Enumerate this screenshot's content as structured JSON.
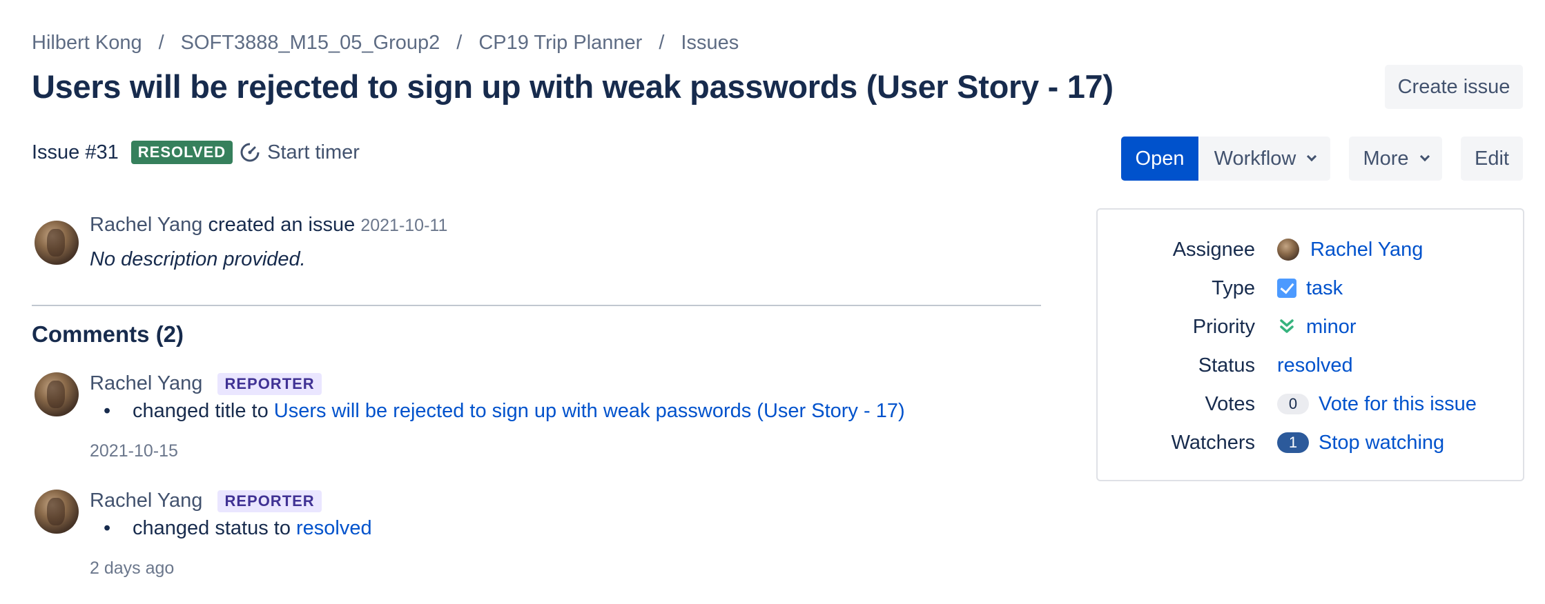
{
  "breadcrumb": {
    "items": [
      "Hilbert Kong",
      "SOFT3888_M15_05_Group2",
      "CP19 Trip Planner",
      "Issues"
    ],
    "separator": "/"
  },
  "title": "Users will be rejected to sign up with weak passwords (User Story - 17)",
  "toolbar": {
    "create_issue": "Create issue",
    "open": "Open",
    "workflow": "Workflow",
    "more": "More",
    "edit": "Edit"
  },
  "issue": {
    "number": "Issue #31",
    "status_badge": "RESOLVED",
    "start_timer": "Start timer"
  },
  "creation": {
    "user": "Rachel Yang",
    "action": "created an issue",
    "date": "2021-10-11",
    "description": "No description provided."
  },
  "comments": {
    "heading": "Comments (2)",
    "items": [
      {
        "user": "Rachel Yang",
        "role": "REPORTER",
        "action": "changed title to",
        "target": "Users will be rejected to sign up with weak passwords (User Story - 17)",
        "date": "2021-10-15"
      },
      {
        "user": "Rachel Yang",
        "role": "REPORTER",
        "action": "changed status to",
        "target": "resolved",
        "date": "2 days ago"
      }
    ]
  },
  "details": {
    "assignee": {
      "label": "Assignee",
      "value": "Rachel Yang"
    },
    "type": {
      "label": "Type",
      "value": "task",
      "icon": "task-checkbox-icon"
    },
    "priority": {
      "label": "Priority",
      "value": "minor",
      "icon": "chevron-double-down-icon"
    },
    "status": {
      "label": "Status",
      "value": "resolved"
    },
    "votes": {
      "label": "Votes",
      "count": "0",
      "action": "Vote for this issue"
    },
    "watchers": {
      "label": "Watchers",
      "count": "1",
      "action": "Stop watching"
    }
  },
  "colors": {
    "primary": "#0052cc",
    "resolved_badge": "#36805c",
    "reporter_badge_bg": "#eae6ff",
    "reporter_badge_text": "#403294",
    "heading": "#172b4d"
  }
}
